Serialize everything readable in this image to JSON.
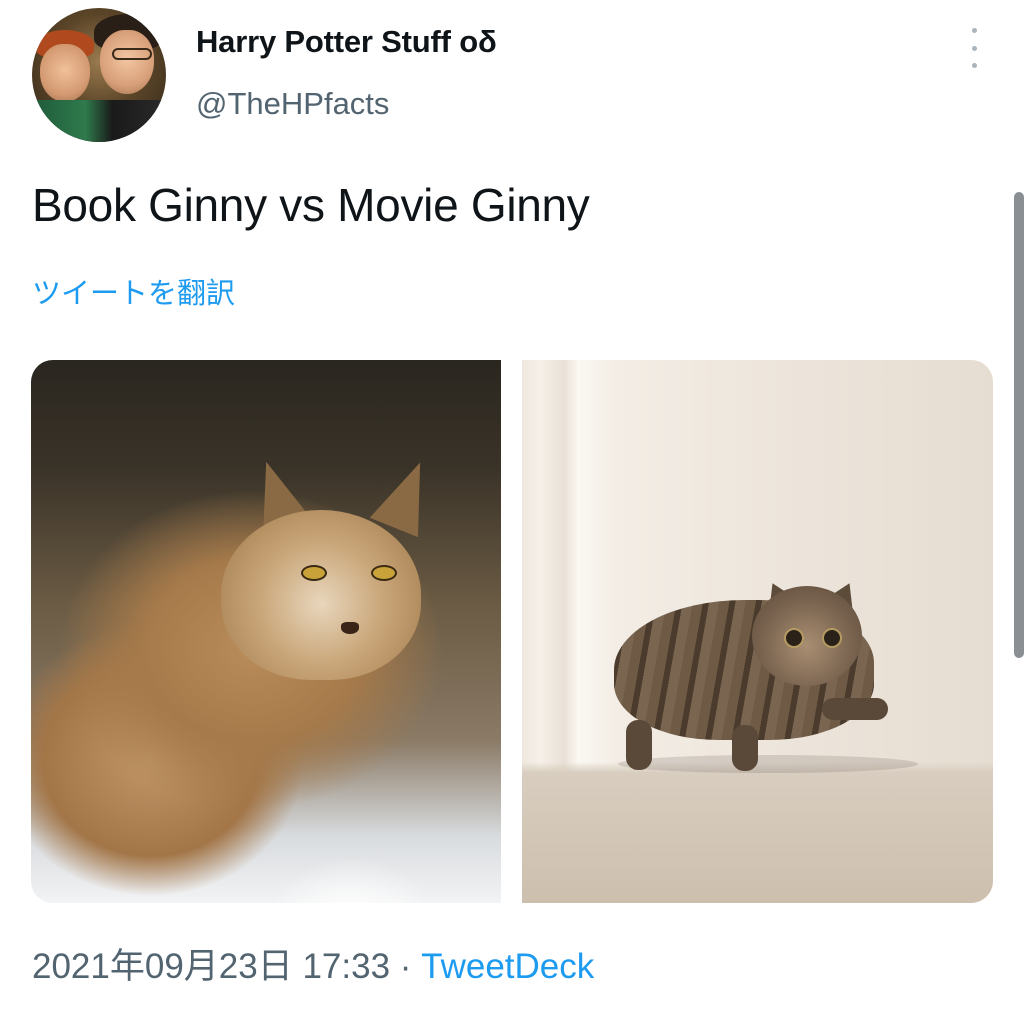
{
  "tweet": {
    "display_name": "Harry Potter Stuff",
    "name_emoji": "oδ",
    "handle": "@TheHPfacts",
    "text": "Book Ginny vs Movie Ginny",
    "translate_label": "ツイートを翻訳",
    "timestamp": "2021年09月23日 17:33",
    "separator": " · ",
    "source": "TweetDeck"
  },
  "icons": {
    "more": "more-vertical-icon",
    "avatar": "profile-avatar"
  },
  "colors": {
    "link": "#1d9bf0",
    "secondary_text": "#536471",
    "primary_text": "#0f1419"
  }
}
